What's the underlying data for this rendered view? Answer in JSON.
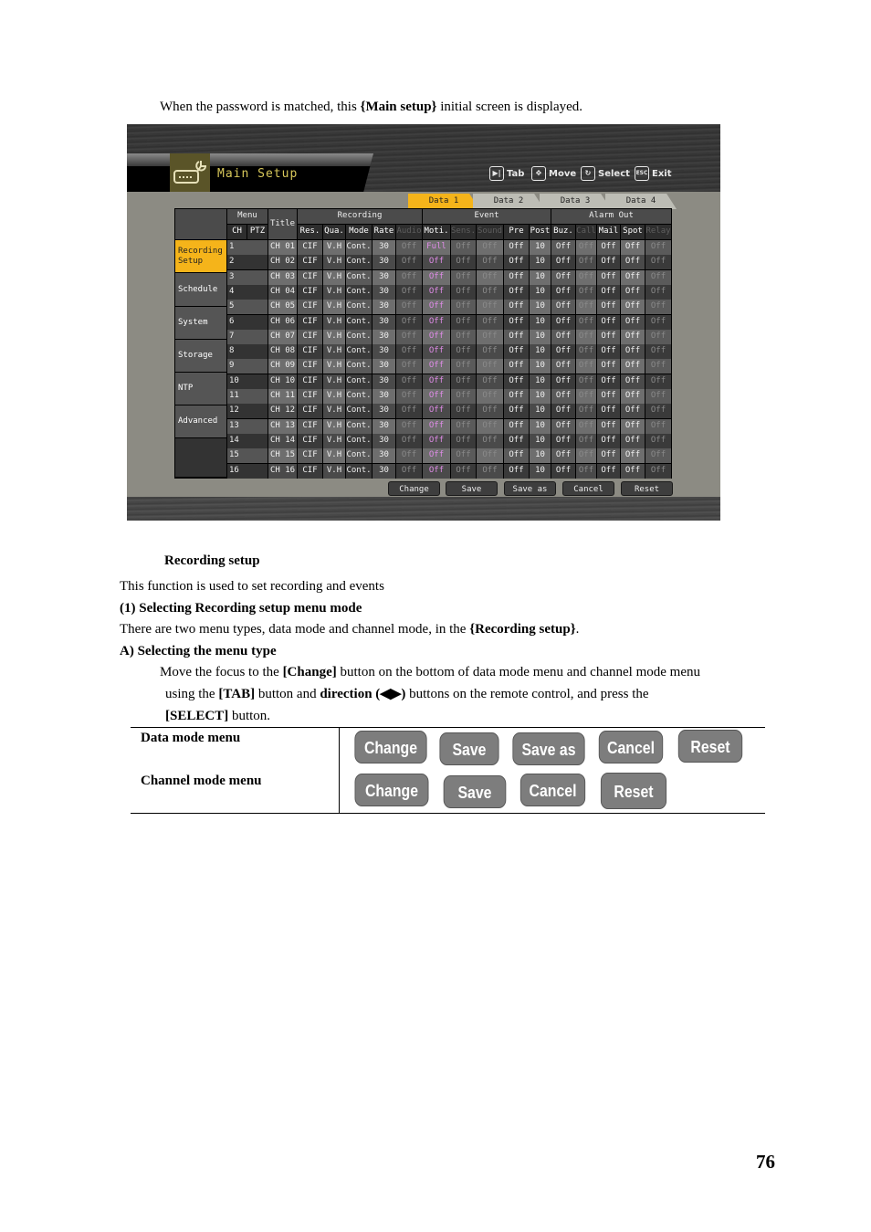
{
  "intro": {
    "prefix": "When the password is matched, this ",
    "bold": "{Main setup}",
    "suffix": " initial screen is displayed."
  },
  "dvr": {
    "title": "Main Setup",
    "title_icon": "dvr-wrench-icon",
    "hints": [
      {
        "icon": "tab-icon",
        "glyph": "▶|",
        "label": "Tab"
      },
      {
        "icon": "move-icon",
        "glyph": "✥",
        "label": "Move"
      },
      {
        "icon": "select-icon",
        "glyph": "↻",
        "label": "Select"
      },
      {
        "icon": "esc-icon",
        "glyph": "ESC",
        "label": "Exit"
      }
    ],
    "tabs": [
      {
        "label": "Data 1",
        "active": true
      },
      {
        "label": "Data 2",
        "active": false
      },
      {
        "label": "Data 3",
        "active": false
      },
      {
        "label": "Data 4",
        "active": false
      }
    ],
    "menu": [
      {
        "label": "Recording Setup",
        "active": true
      },
      {
        "label": "Schedule",
        "active": false
      },
      {
        "label": "System",
        "active": false
      },
      {
        "label": "Storage",
        "active": false
      },
      {
        "label": "NTP",
        "active": false
      },
      {
        "label": "Advanced",
        "active": false
      }
    ],
    "group_headers": {
      "menu": "Menu",
      "title": "Title",
      "recording": "Recording",
      "event": "Event",
      "alarm_out": "Alarm Out"
    },
    "columns": [
      {
        "key": "ch",
        "label": "CH",
        "dim": false
      },
      {
        "key": "ptz",
        "label": "PTZ",
        "dim": false
      },
      {
        "key": "title",
        "label": "",
        "dim": false
      },
      {
        "key": "res",
        "label": "Res.",
        "dim": false
      },
      {
        "key": "qua",
        "label": "Qua.",
        "dim": false
      },
      {
        "key": "mode",
        "label": "Mode",
        "dim": false
      },
      {
        "key": "rate",
        "label": "Rate",
        "dim": false
      },
      {
        "key": "audio",
        "label": "Audio",
        "dim": true
      },
      {
        "key": "moti",
        "label": "Moti.",
        "dim": false
      },
      {
        "key": "sens",
        "label": "Sens.",
        "dim": true
      },
      {
        "key": "sound",
        "label": "Sound",
        "dim": true
      },
      {
        "key": "pre",
        "label": "Pre",
        "dim": false
      },
      {
        "key": "post",
        "label": "Post",
        "dim": false
      },
      {
        "key": "buz",
        "label": "Buz.",
        "dim": false
      },
      {
        "key": "call",
        "label": "Call",
        "dim": true
      },
      {
        "key": "mail",
        "label": "Mail",
        "dim": false
      },
      {
        "key": "spot",
        "label": "Spot",
        "dim": false
      },
      {
        "key": "relay",
        "label": "Relay",
        "dim": true
      }
    ],
    "rows": [
      {
        "ch": "1",
        "title": "CH 01",
        "res": "CIF",
        "qua": "V.H",
        "mode": "Cont.",
        "rate": "30",
        "audio": "Off",
        "moti": "Full",
        "sens": "Off",
        "sound": "Off",
        "pre": "Off",
        "post": "10",
        "buz": "Off",
        "call": "Off",
        "mail": "Off",
        "spot": "Off",
        "relay": "Off"
      },
      {
        "ch": "2",
        "title": "CH 02",
        "res": "CIF",
        "qua": "V.H",
        "mode": "Cont.",
        "rate": "30",
        "audio": "Off",
        "moti": "Off",
        "sens": "Off",
        "sound": "Off",
        "pre": "Off",
        "post": "10",
        "buz": "Off",
        "call": "Off",
        "mail": "Off",
        "spot": "Off",
        "relay": "Off"
      },
      {
        "ch": "3",
        "title": "CH 03",
        "res": "CIF",
        "qua": "V.H",
        "mode": "Cont.",
        "rate": "30",
        "audio": "Off",
        "moti": "Off",
        "sens": "Off",
        "sound": "Off",
        "pre": "Off",
        "post": "10",
        "buz": "Off",
        "call": "Off",
        "mail": "Off",
        "spot": "Off",
        "relay": "Off"
      },
      {
        "ch": "4",
        "title": "CH 04",
        "res": "CIF",
        "qua": "V.H",
        "mode": "Cont.",
        "rate": "30",
        "audio": "Off",
        "moti": "Off",
        "sens": "Off",
        "sound": "Off",
        "pre": "Off",
        "post": "10",
        "buz": "Off",
        "call": "Off",
        "mail": "Off",
        "spot": "Off",
        "relay": "Off"
      },
      {
        "ch": "5",
        "title": "CH 05",
        "res": "CIF",
        "qua": "V.H",
        "mode": "Cont.",
        "rate": "30",
        "audio": "Off",
        "moti": "Off",
        "sens": "Off",
        "sound": "Off",
        "pre": "Off",
        "post": "10",
        "buz": "Off",
        "call": "Off",
        "mail": "Off",
        "spot": "Off",
        "relay": "Off"
      },
      {
        "ch": "6",
        "title": "CH 06",
        "res": "CIF",
        "qua": "V.H",
        "mode": "Cont.",
        "rate": "30",
        "audio": "Off",
        "moti": "Off",
        "sens": "Off",
        "sound": "Off",
        "pre": "Off",
        "post": "10",
        "buz": "Off",
        "call": "Off",
        "mail": "Off",
        "spot": "Off",
        "relay": "Off"
      },
      {
        "ch": "7",
        "title": "CH 07",
        "res": "CIF",
        "qua": "V.H",
        "mode": "Cont.",
        "rate": "30",
        "audio": "Off",
        "moti": "Off",
        "sens": "Off",
        "sound": "Off",
        "pre": "Off",
        "post": "10",
        "buz": "Off",
        "call": "Off",
        "mail": "Off",
        "spot": "Off",
        "relay": "Off"
      },
      {
        "ch": "8",
        "title": "CH 08",
        "res": "CIF",
        "qua": "V.H",
        "mode": "Cont.",
        "rate": "30",
        "audio": "Off",
        "moti": "Off",
        "sens": "Off",
        "sound": "Off",
        "pre": "Off",
        "post": "10",
        "buz": "Off",
        "call": "Off",
        "mail": "Off",
        "spot": "Off",
        "relay": "Off"
      },
      {
        "ch": "9",
        "title": "CH 09",
        "res": "CIF",
        "qua": "V.H",
        "mode": "Cont.",
        "rate": "30",
        "audio": "Off",
        "moti": "Off",
        "sens": "Off",
        "sound": "Off",
        "pre": "Off",
        "post": "10",
        "buz": "Off",
        "call": "Off",
        "mail": "Off",
        "spot": "Off",
        "relay": "Off"
      },
      {
        "ch": "10",
        "title": "CH 10",
        "res": "CIF",
        "qua": "V.H",
        "mode": "Cont.",
        "rate": "30",
        "audio": "Off",
        "moti": "Off",
        "sens": "Off",
        "sound": "Off",
        "pre": "Off",
        "post": "10",
        "buz": "Off",
        "call": "Off",
        "mail": "Off",
        "spot": "Off",
        "relay": "Off"
      },
      {
        "ch": "11",
        "title": "CH 11",
        "res": "CIF",
        "qua": "V.H",
        "mode": "Cont.",
        "rate": "30",
        "audio": "Off",
        "moti": "Off",
        "sens": "Off",
        "sound": "Off",
        "pre": "Off",
        "post": "10",
        "buz": "Off",
        "call": "Off",
        "mail": "Off",
        "spot": "Off",
        "relay": "Off"
      },
      {
        "ch": "12",
        "title": "CH 12",
        "res": "CIF",
        "qua": "V.H",
        "mode": "Cont.",
        "rate": "30",
        "audio": "Off",
        "moti": "Off",
        "sens": "Off",
        "sound": "Off",
        "pre": "Off",
        "post": "10",
        "buz": "Off",
        "call": "Off",
        "mail": "Off",
        "spot": "Off",
        "relay": "Off"
      },
      {
        "ch": "13",
        "title": "CH 13",
        "res": "CIF",
        "qua": "V.H",
        "mode": "Cont.",
        "rate": "30",
        "audio": "Off",
        "moti": "Off",
        "sens": "Off",
        "sound": "Off",
        "pre": "Off",
        "post": "10",
        "buz": "Off",
        "call": "Off",
        "mail": "Off",
        "spot": "Off",
        "relay": "Off"
      },
      {
        "ch": "14",
        "title": "CH 14",
        "res": "CIF",
        "qua": "V.H",
        "mode": "Cont.",
        "rate": "30",
        "audio": "Off",
        "moti": "Off",
        "sens": "Off",
        "sound": "Off",
        "pre": "Off",
        "post": "10",
        "buz": "Off",
        "call": "Off",
        "mail": "Off",
        "spot": "Off",
        "relay": "Off"
      },
      {
        "ch": "15",
        "title": "CH 15",
        "res": "CIF",
        "qua": "V.H",
        "mode": "Cont.",
        "rate": "30",
        "audio": "Off",
        "moti": "Off",
        "sens": "Off",
        "sound": "Off",
        "pre": "Off",
        "post": "10",
        "buz": "Off",
        "call": "Off",
        "mail": "Off",
        "spot": "Off",
        "relay": "Off"
      },
      {
        "ch": "16",
        "title": "CH 16",
        "res": "CIF",
        "qua": "V.H",
        "mode": "Cont.",
        "rate": "30",
        "audio": "Off",
        "moti": "Off",
        "sens": "Off",
        "sound": "Off",
        "pre": "Off",
        "post": "10",
        "buz": "Off",
        "call": "Off",
        "mail": "Off",
        "spot": "Off",
        "relay": "Off"
      }
    ],
    "buttons": [
      "Change",
      "Save",
      "Save as",
      "Cancel",
      "Reset"
    ]
  },
  "section": {
    "heading": "Recording setup",
    "desc": "This function is used to set recording and events",
    "sub1": "(1)  Selecting Recording setup menu mode",
    "para1_prefix": "There are two menu types, data mode and channel mode, in the ",
    "para1_bold": "{Recording setup}",
    "para1_suffix": ".",
    "sub2": "A)  Selecting the menu type",
    "para2": {
      "t1": "Move the focus to the ",
      "b1": "[Change]",
      "t2": " button on the bottom of data mode menu and channel mode menu",
      "t3": "using the ",
      "b2": "[TAB]",
      "t4": " button and ",
      "b3": "direction (◀▶)",
      "t5": " buttons on the remote control, and press the",
      "b4": "[SELECT]",
      "t6": " button."
    }
  },
  "menu_table": {
    "rows": [
      {
        "label": "Data mode menu",
        "buttons": [
          "Change",
          "Save",
          "Save as",
          "Cancel",
          "Reset"
        ]
      },
      {
        "label": "Channel mode menu",
        "buttons": [
          "Change",
          "Save",
          "Cancel",
          "Reset"
        ]
      }
    ]
  },
  "page_number": "76"
}
